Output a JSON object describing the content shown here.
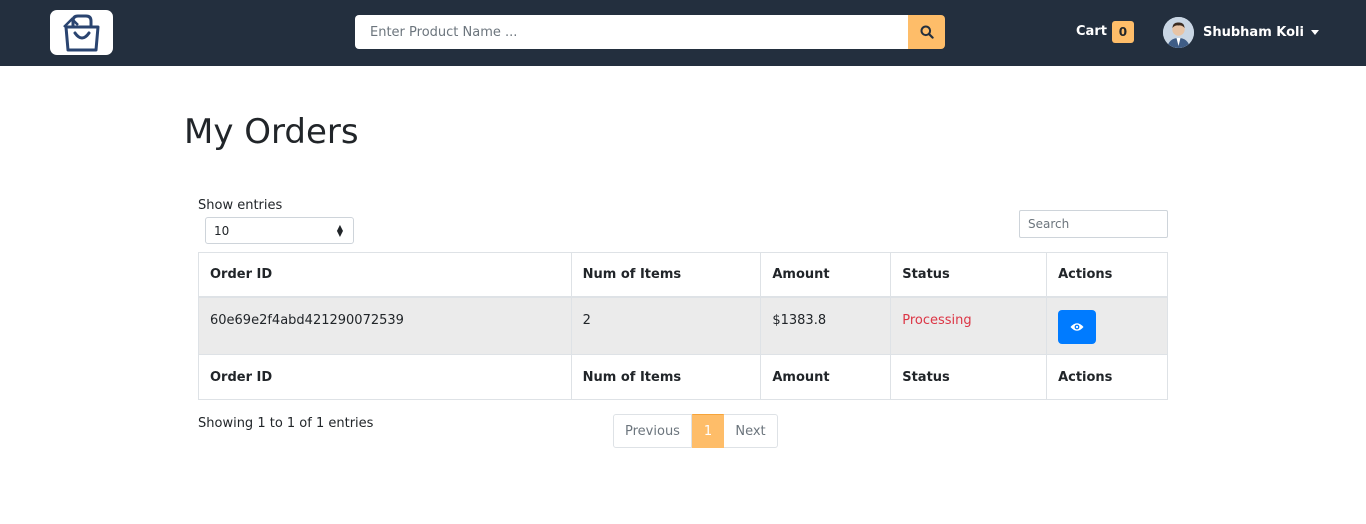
{
  "header": {
    "logo_icon": "shopping-bag-icon",
    "search": {
      "placeholder": "Enter Product Name ...",
      "value": ""
    },
    "search_icon": "search-icon",
    "cart": {
      "label": "Cart",
      "count": "0"
    },
    "user": {
      "name": "Shubham Koli"
    }
  },
  "page": {
    "title": "My Orders"
  },
  "table_controls": {
    "show_entries_label": "Show entries",
    "entries_selected": "10",
    "search_placeholder": "Search"
  },
  "orders_table": {
    "columns": [
      "Order ID",
      "Num of Items",
      "Amount",
      "Status",
      "Actions"
    ],
    "rows": [
      {
        "order_id": "60e69e2f4abd421290072539",
        "num_items": "2",
        "amount": "$1383.8",
        "status": "Processing"
      }
    ]
  },
  "footer": {
    "showing_text": "Showing 1 to 1 of 1 entries",
    "pagination": {
      "previous": "Previous",
      "current": "1",
      "next": "Next"
    }
  },
  "colors": {
    "navbar": "#232f3e",
    "accent": "#febd69",
    "status_processing": "#dc3545",
    "primary_button": "#007bff"
  }
}
